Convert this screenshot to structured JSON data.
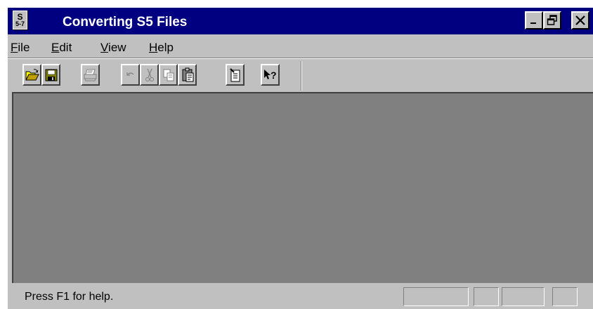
{
  "window": {
    "title": "Converting S5 Files",
    "app_icon_top": "S",
    "app_icon_bottom": "5-7"
  },
  "title_buttons": {
    "minimize": "_",
    "maximize": "🗗",
    "close": "✕"
  },
  "menu": [
    {
      "accel": "F",
      "rest": "ile"
    },
    {
      "accel": "E",
      "rest": "dit"
    },
    {
      "accel": "V",
      "rest": "iew"
    },
    {
      "accel": "H",
      "rest": "elp"
    }
  ],
  "toolbar": {
    "buttons": [
      {
        "icon": "open-folder-icon",
        "enabled": true
      },
      {
        "icon": "save-disk-icon",
        "enabled": true
      },
      {
        "icon": "print-icon",
        "enabled": false
      },
      {
        "icon": "undo-icon",
        "enabled": false
      },
      {
        "icon": "cut-icon",
        "enabled": false
      },
      {
        "icon": "copy-icon",
        "enabled": false
      },
      {
        "icon": "paste-icon",
        "enabled": true
      },
      {
        "icon": "properties-icon",
        "enabled": true
      },
      {
        "icon": "context-help-icon",
        "enabled": true
      }
    ]
  },
  "status": {
    "text": "Press F1 for help."
  },
  "colors": {
    "titlebar": "#000080",
    "face": "#c0c0c0",
    "client": "#808080"
  }
}
